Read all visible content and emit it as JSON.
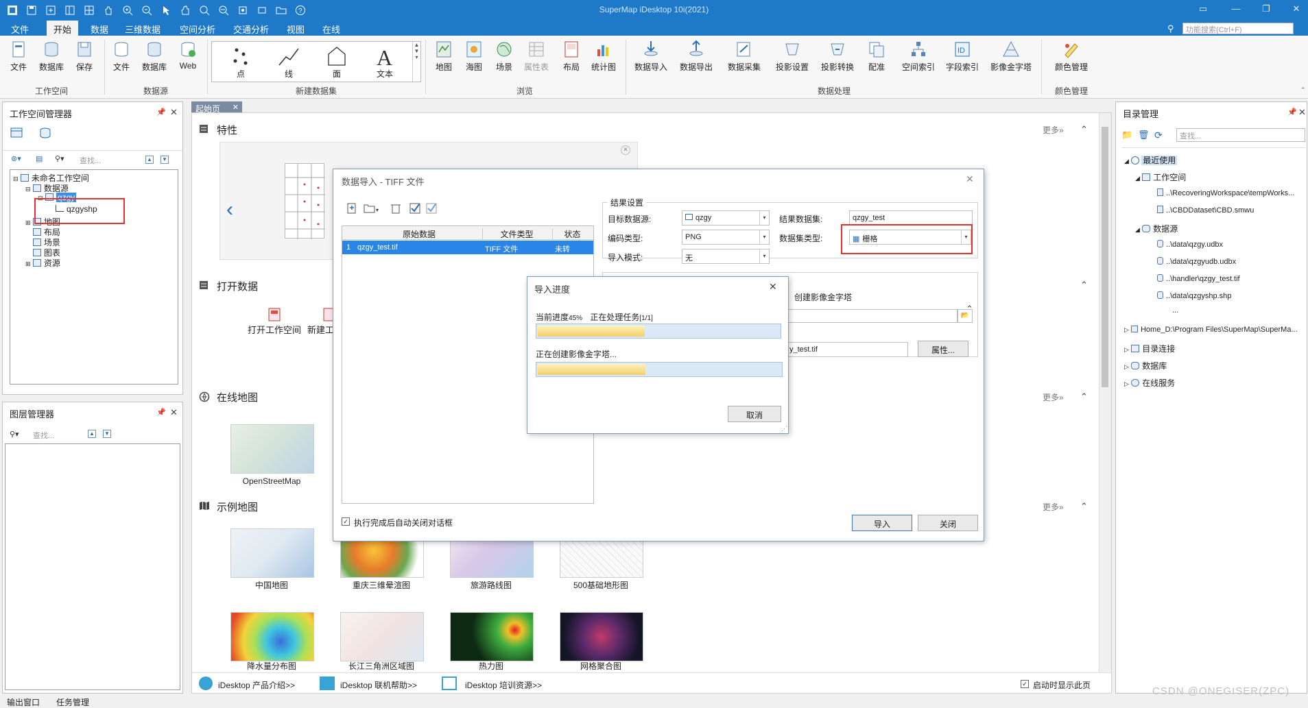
{
  "titlebar": {
    "title": "SuperMap iDesktop 10i(2021)"
  },
  "menu": {
    "items": [
      "文件",
      "开始",
      "数据",
      "三维数据",
      "空间分析",
      "交通分析",
      "视图",
      "在线"
    ],
    "search_placeholder": "功能搜索(Ctrl+F)"
  },
  "ribbon": {
    "buttons": [
      "文件",
      "数据库",
      "保存",
      "文件",
      "数据库",
      "Web",
      "地图",
      "海图",
      "场景",
      "属性表",
      "布局",
      "统计图",
      "数据导入",
      "数据导出",
      "数据采集",
      "投影设置",
      "投影转换",
      "配准",
      "空间索引",
      "字段索引",
      "影像金字塔",
      "颜色管理"
    ],
    "gallery": [
      "点",
      "线",
      "面",
      "文本"
    ],
    "groups": [
      "工作空间",
      "数据源",
      "新建数据集",
      "浏览",
      "数据处理",
      "颜色管理"
    ]
  },
  "workspace_panel": {
    "title": "工作空间管理器",
    "search_placeholder": "查找...",
    "tree": [
      "未命名工作空间",
      "数据源",
      "qzgy",
      "qzgyshp",
      "地图",
      "布局",
      "场景",
      "图表",
      "资源"
    ]
  },
  "layer_panel": {
    "title": "图层管理器",
    "search_placeholder": "查找..."
  },
  "catalog_panel": {
    "title": "目录管理",
    "search_placeholder": "查找...",
    "tree": [
      "最近使用",
      "工作空间",
      "..\\RecoveringWorkspace\\tempWorks...",
      "..\\CBDDataset\\CBD.smwu",
      "数据源",
      "..\\data\\qzgy.udbx",
      "..\\data\\qzgyudb.udbx",
      "..\\handler\\qzgy_test.tif",
      "..\\data\\qzgyshp.shp",
      "...",
      "Home_D:\\Program Files\\SuperMap\\SuperMa...",
      "目录连接",
      "数据库",
      "在线服务"
    ]
  },
  "doc_tab": {
    "label": "起始页"
  },
  "startpage": {
    "sections": [
      "特性",
      "打开数据",
      "在线地图",
      "示例地图"
    ],
    "more": "更多»",
    "open_items": [
      "打开工作空间",
      "新建工"
    ],
    "online_maps": [
      "OpenStreetMap"
    ],
    "sample_maps": [
      "中国地图",
      "重庆三维晕渲图",
      "旅游路线图",
      "500基础地形图",
      "降水量分布图",
      "长江三角洲区域图",
      "热力图",
      "网格聚合图"
    ],
    "footer_links": [
      "iDesktop 产品介绍>>",
      "iDesktop 联机帮助>>",
      "iDesktop 培训资源>>"
    ],
    "show_on_start": "启动时显示此页"
  },
  "bottom_tabs": [
    "输出窗口",
    "任务管理"
  ],
  "import_dialog": {
    "title": "数据导入 - TIFF 文件",
    "table_headers": [
      "原始数据",
      "文件类型",
      "状态"
    ],
    "rows": [
      {
        "index": "1",
        "name": "qzgy_test.tif",
        "type": "TIFF 文件",
        "status": "未转"
      }
    ],
    "result_group": "结果设置",
    "target_ds_label": "目标数据源:",
    "target_ds": "qzgy",
    "result_dataset_label": "结果数据集:",
    "result_dataset": "qzgy_test",
    "encode_label": "编码类型:",
    "encode": "PNG",
    "dataset_type_label": "数据集类型:",
    "dataset_type": "栅格",
    "import_mode_label": "导入模式:",
    "import_mode": "无",
    "pyramid_label": "创建影像金字塔",
    "source_file_partial": "y_test.tif",
    "properties_btn": "属性...",
    "auto_close": "执行完成后自动关闭对话框",
    "import_btn": "导入",
    "close_btn": "关闭"
  },
  "progress_dialog": {
    "title": "导入进度",
    "current_label": "当前进度",
    "current_pct": "45%",
    "task_label": "正在处理任务",
    "task_count": "[1/1]",
    "percent": 45,
    "pyramid_label": "正在创建影像金字塔...",
    "pyramid_percent": 45,
    "cancel_btn": "取消"
  },
  "watermark": "CSDN @ONEGISER(ZPC)"
}
